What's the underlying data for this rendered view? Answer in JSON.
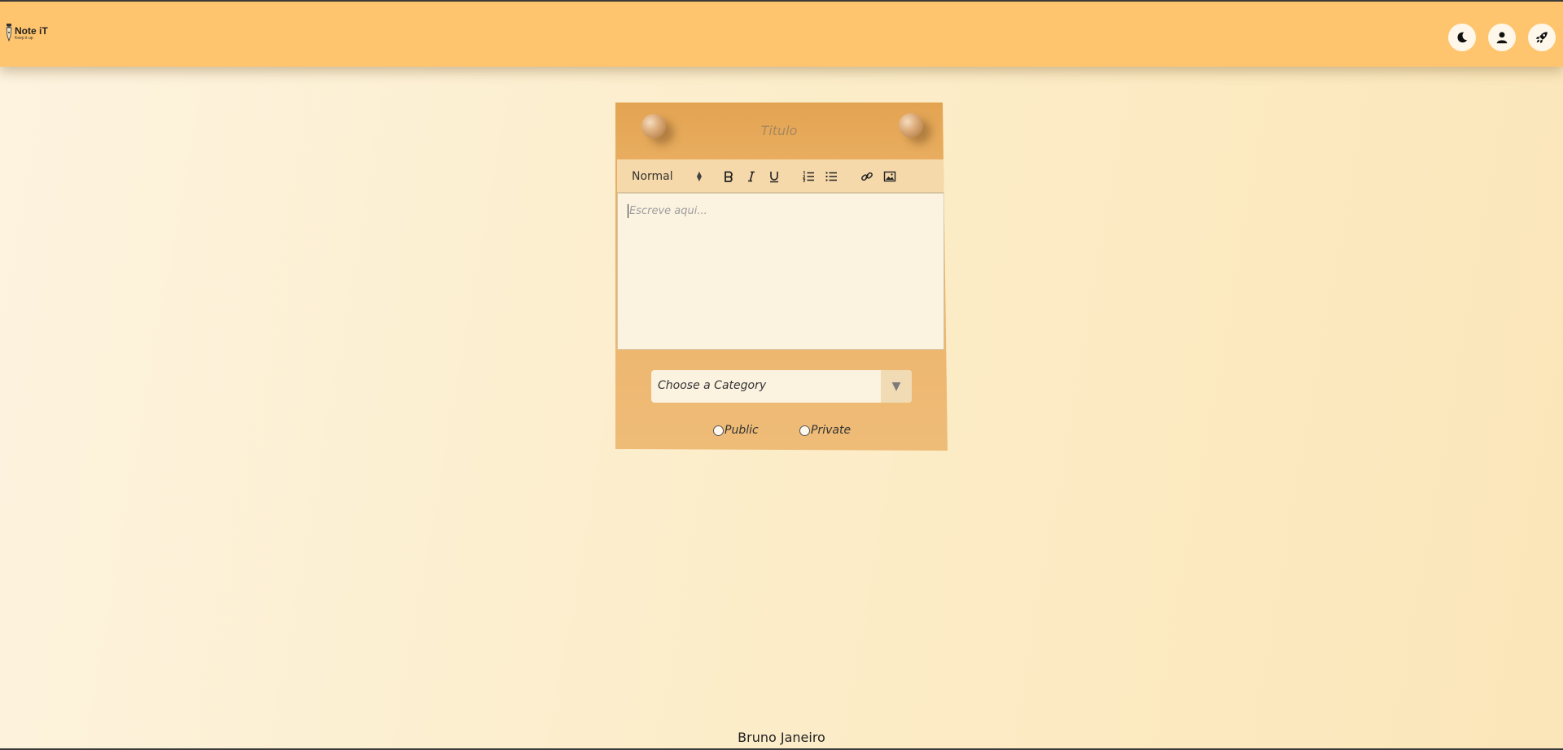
{
  "header": {
    "logo_title": "Note iT",
    "logo_subtitle": "Keep it up",
    "buttons": [
      {
        "icon": "moon-icon",
        "name": "theme-toggle-button"
      },
      {
        "icon": "user-icon",
        "name": "profile-button"
      },
      {
        "icon": "rocket-icon",
        "name": "launch-button"
      }
    ]
  },
  "note": {
    "title_placeholder": "Titulo",
    "toolbar": {
      "format_select": "Normal",
      "buttons": [
        "bold",
        "italic",
        "underline",
        "ordered-list",
        "bullet-list",
        "link",
        "image"
      ]
    },
    "editor_placeholder": "Escreve aqui...",
    "category_select": "Choose a Category",
    "visibility": {
      "public_label": "Public",
      "private_label": "Private"
    }
  },
  "footer": {
    "author": "Bruno Janeiro"
  },
  "colors": {
    "header": "#ffc46e",
    "note": "#ebb36a",
    "editor": "#fbf2e0"
  }
}
